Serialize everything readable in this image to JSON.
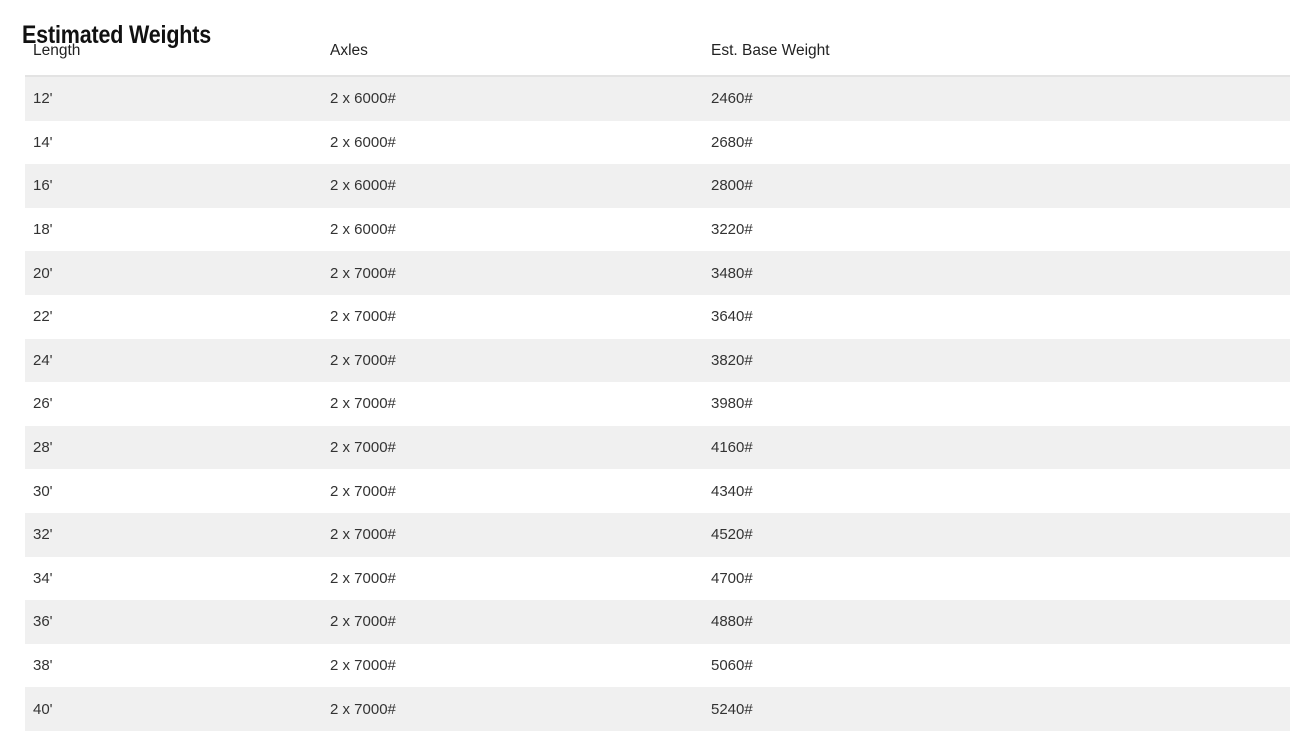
{
  "page": {
    "title": "Estimated Weights"
  },
  "table": {
    "columns": [
      {
        "key": "length",
        "label": "Length"
      },
      {
        "key": "axles",
        "label": "Axles"
      },
      {
        "key": "weight",
        "label": "Est. Base Weight"
      }
    ],
    "rows": [
      {
        "length": "12'",
        "axles": "2 x 6000#",
        "weight": "2460#"
      },
      {
        "length": "14'",
        "axles": "2 x 6000#",
        "weight": "2680#"
      },
      {
        "length": "16'",
        "axles": "2 x 6000#",
        "weight": "2800#"
      },
      {
        "length": "18'",
        "axles": "2 x 6000#",
        "weight": "3220#"
      },
      {
        "length": "20'",
        "axles": "2 x 7000#",
        "weight": "3480#"
      },
      {
        "length": "22'",
        "axles": "2 x 7000#",
        "weight": "3640#"
      },
      {
        "length": "24'",
        "axles": "2 x 7000#",
        "weight": "3820#"
      },
      {
        "length": "26'",
        "axles": "2 x 7000#",
        "weight": "3980#"
      },
      {
        "length": "28'",
        "axles": "2 x 7000#",
        "weight": "4160#"
      },
      {
        "length": "30'",
        "axles": "2 x 7000#",
        "weight": "4340#"
      },
      {
        "length": "32'",
        "axles": "2 x 7000#",
        "weight": "4520#"
      },
      {
        "length": "34'",
        "axles": "2 x 7000#",
        "weight": "4700#"
      },
      {
        "length": "36'",
        "axles": "2 x 7000#",
        "weight": "4880#"
      },
      {
        "length": "38'",
        "axles": "2 x 7000#",
        "weight": "5060#"
      },
      {
        "length": "40'",
        "axles": "2 x 7000#",
        "weight": "5240#"
      }
    ]
  },
  "colors": {
    "stripe": "#f0f0f0",
    "background": "#ffffff",
    "text": "#333333",
    "heading": "#111111",
    "header_rule": "#e3e3e3"
  }
}
